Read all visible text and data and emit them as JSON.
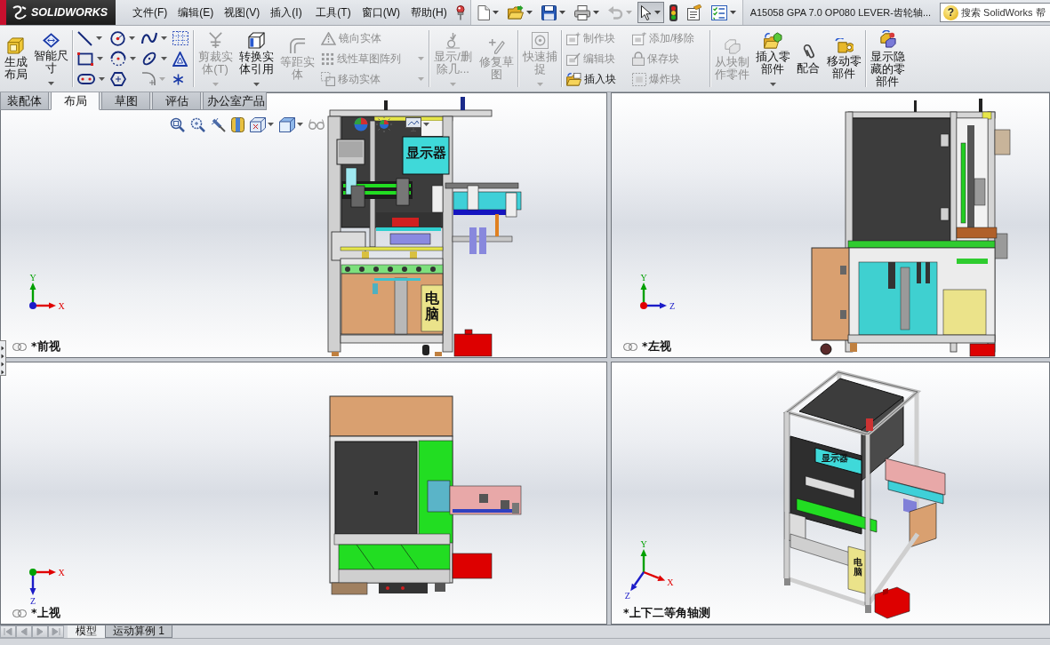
{
  "title_bar": {
    "app_name": "SOLIDWORKS",
    "menus": [
      "文件(F)",
      "编辑(E)",
      "视图(V)",
      "插入(I)",
      "工具(T)",
      "窗口(W)",
      "帮助(H)"
    ],
    "quick_access": [
      {
        "dropdown": true,
        "disabled": false,
        "pressed": false
      },
      {
        "dropdown": true,
        "disabled": false,
        "pressed": false
      },
      {
        "dropdown": true,
        "disabled": false,
        "pressed": false
      },
      {
        "dropdown": true,
        "disabled": false,
        "pressed": false
      },
      {
        "dropdown": true,
        "disabled": true,
        "pressed": false
      },
      {
        "dropdown": true,
        "disabled": false,
        "pressed": true
      },
      {
        "dropdown": false,
        "disabled": false,
        "pressed": false
      },
      {
        "dropdown": false,
        "disabled": false,
        "pressed": false
      },
      {
        "dropdown": true,
        "disabled": false,
        "pressed": false
      }
    ],
    "document_title": "A15058 GPA 7.0 OP080 LEVER-齿轮轴...",
    "search": {
      "icon_glyph": "?",
      "placeholder": "搜索 SolidWorks 帮"
    }
  },
  "command_manager": {
    "sections": [
      {
        "blocks": [
          {
            "kind": "large",
            "items": [
              {
                "label": "生成布局",
                "disabled": false,
                "dropdown": false
              },
              {
                "label": "智能尺寸",
                "disabled": false,
                "dropdown": true
              }
            ]
          }
        ]
      },
      {
        "blocks": [
          {
            "kind": "grid",
            "items": [
              {
                "disabled": false,
                "dropdown": true
              },
              {
                "disabled": false,
                "dropdown": true
              },
              {
                "disabled": false,
                "dropdown": true
              },
              {
                "disabled": false,
                "dropdown": false
              },
              {
                "disabled": false,
                "dropdown": true
              },
              {
                "disabled": false,
                "dropdown": true
              },
              {
                "disabled": false,
                "dropdown": true
              },
              {
                "disabled": false,
                "dropdown": false
              },
              {
                "disabled": false,
                "dropdown": true
              },
              {
                "disabled": false,
                "dropdown": false
              },
              {
                "disabled": true,
                "dropdown": true
              },
              {
                "disabled": false,
                "dropdown": false
              }
            ]
          }
        ]
      },
      {
        "blocks": [
          {
            "kind": "large",
            "items": [
              {
                "label": "剪裁实体(T)",
                "disabled": true,
                "dropdown": true
              },
              {
                "label": "转换实体引用",
                "disabled": false,
                "dropdown": true
              },
              {
                "label": "等距实体",
                "disabled": true,
                "dropdown": false
              }
            ]
          },
          {
            "kind": "stack",
            "items": [
              {
                "label": "镜向实体",
                "disabled": true,
                "dropdown": false
              },
              {
                "label": "线性草图阵列",
                "disabled": true,
                "dropdown": true
              },
              {
                "label": "移动实体",
                "disabled": true,
                "dropdown": true
              }
            ]
          }
        ]
      },
      {
        "blocks": [
          {
            "kind": "large",
            "items": [
              {
                "label": "显示/删除几...",
                "disabled": true,
                "dropdown": true
              },
              {
                "label": "修复草图",
                "disabled": true,
                "dropdown": false
              }
            ]
          }
        ]
      },
      {
        "blocks": [
          {
            "kind": "large",
            "items": [
              {
                "label": "快速捕捉",
                "disabled": true,
                "dropdown": true
              }
            ]
          }
        ]
      },
      {
        "blocks": [
          {
            "kind": "stack",
            "items": [
              {
                "label": "制作块",
                "disabled": true,
                "dropdown": false
              },
              {
                "label": "编辑块",
                "disabled": true,
                "dropdown": false
              },
              {
                "label": "插入块",
                "disabled": false,
                "dropdown": false
              }
            ]
          },
          {
            "kind": "stack",
            "items": [
              {
                "label": "添加/移除",
                "disabled": true,
                "dropdown": false
              },
              {
                "label": "保存块",
                "disabled": true,
                "dropdown": false
              },
              {
                "label": "爆炸块",
                "disabled": true,
                "dropdown": false
              }
            ]
          }
        ]
      },
      {
        "blocks": [
          {
            "kind": "large",
            "items": [
              {
                "label": "从块制作零件",
                "disabled": true,
                "dropdown": false
              },
              {
                "label": "插入零部件",
                "disabled": false,
                "dropdown": true
              },
              {
                "label": "配合",
                "disabled": false,
                "dropdown": false
              },
              {
                "label": "移动零部件",
                "disabled": false,
                "dropdown": false
              }
            ]
          }
        ]
      },
      {
        "blocks": [
          {
            "kind": "large",
            "items": [
              {
                "label": "显示隐藏的零部件",
                "disabled": false,
                "dropdown": false
              }
            ]
          }
        ]
      }
    ],
    "tabs": [
      {
        "label": "装配体",
        "selected": false
      },
      {
        "label": "布局",
        "selected": true
      },
      {
        "label": "草图",
        "selected": false
      },
      {
        "label": "评估",
        "selected": false
      },
      {
        "label": "办公室产品",
        "selected": false
      }
    ]
  },
  "graphics": {
    "view_toolbar": [
      {
        "dropdown": false
      },
      {
        "dropdown": false
      },
      {
        "dropdown": false
      },
      {
        "dropdown": false
      },
      {
        "dropdown": true
      },
      {
        "dropdown": true
      },
      {
        "dropdown": false
      },
      {
        "dropdown": false
      },
      {
        "dropdown": false
      },
      {
        "dropdown": true
      }
    ],
    "viewports": [
      {
        "kind": "front",
        "caption": "*前视",
        "linked": true,
        "model_labels": [
          "显示器",
          "电脑"
        ],
        "triad": {
          "origin": {
            "color": "#1c1cc8"
          },
          "axes": [
            {
              "label": "Y",
              "kind": "up",
              "color": "#00a000"
            },
            {
              "label": "X",
              "kind": "right",
              "color": "#e00000"
            }
          ]
        }
      },
      {
        "kind": "left",
        "caption": "*左视",
        "linked": true,
        "triad": {
          "origin": {
            "color": "#e00000"
          },
          "axes": [
            {
              "label": "Y",
              "kind": "up",
              "color": "#00a000"
            },
            {
              "label": "Z",
              "kind": "right",
              "color": "#1c1cc8"
            }
          ]
        }
      },
      {
        "kind": "top",
        "caption": "*上视",
        "linked": true,
        "triad": {
          "origin": {
            "color": "#00a000"
          },
          "axes": [
            {
              "label": "X",
              "kind": "right",
              "color": "#e00000"
            },
            {
              "label": "Z",
              "kind": "down",
              "color": "#1c1cc8"
            }
          ]
        }
      },
      {
        "kind": "iso",
        "caption": "*上下二等角轴测",
        "linked": false,
        "model_labels": [
          "显示器",
          "电脑"
        ],
        "triad": {
          "axes": [
            {
              "label": "Y",
              "kind": "up",
              "color": "#00a000"
            },
            {
              "label": "X",
              "kind": "down-right",
              "color": "#e00000"
            },
            {
              "label": "Z",
              "kind": "down-left",
              "color": "#1c1cc8"
            }
          ]
        }
      }
    ]
  },
  "tab_bar": {
    "scroll_buttons": [
      {
        "disabled": true
      },
      {
        "disabled": true
      },
      {
        "disabled": true
      },
      {
        "disabled": true
      }
    ],
    "tabs": [
      {
        "label": "模型",
        "selected": true
      },
      {
        "label": "运动算例 1",
        "selected": false
      }
    ]
  }
}
